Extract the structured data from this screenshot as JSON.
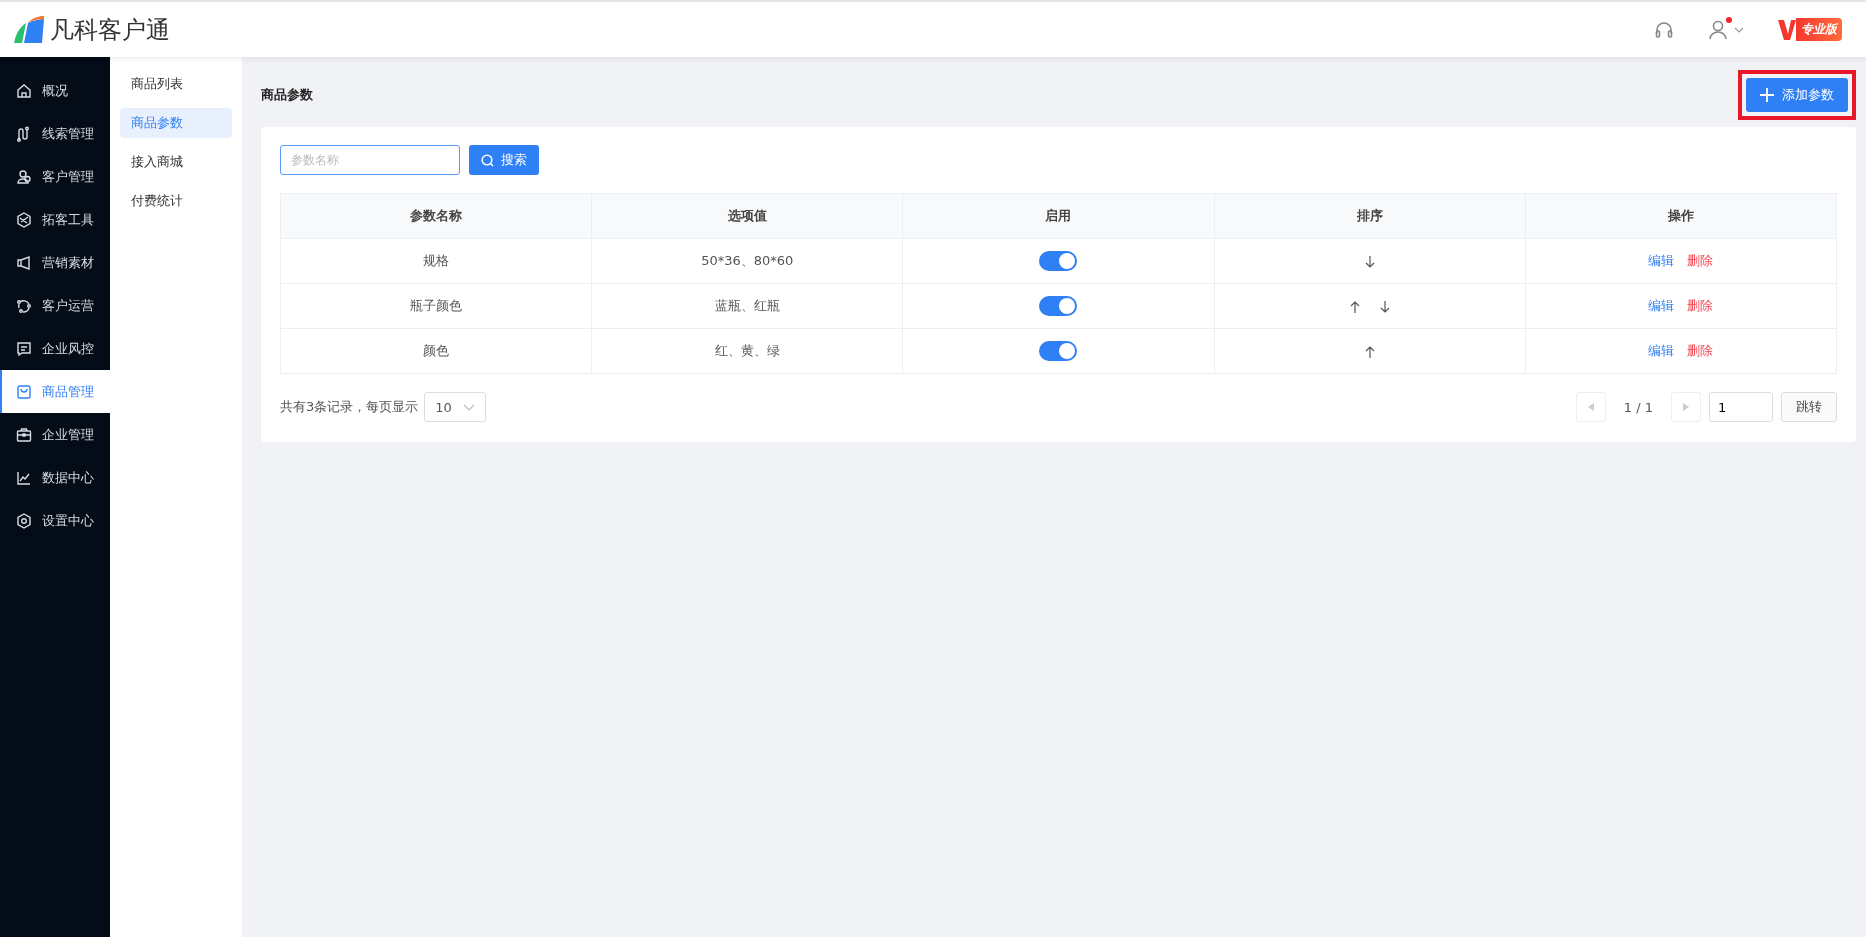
{
  "header": {
    "logo_text": "凡科客户通",
    "edition_badge": "专业版",
    "user_has_notification": true
  },
  "sidebar": {
    "items": [
      {
        "label": "概况",
        "selected": false
      },
      {
        "label": "线索管理",
        "selected": false
      },
      {
        "label": "客户管理",
        "selected": false
      },
      {
        "label": "拓客工具",
        "selected": false
      },
      {
        "label": "营销素材",
        "selected": false
      },
      {
        "label": "客户运营",
        "selected": false
      },
      {
        "label": "企业风控",
        "selected": false
      },
      {
        "label": "商品管理",
        "selected": true
      },
      {
        "label": "企业管理",
        "selected": false
      },
      {
        "label": "数据中心",
        "selected": false
      },
      {
        "label": "设置中心",
        "selected": false
      }
    ]
  },
  "submenu": {
    "items": [
      {
        "label": "商品列表",
        "selected": false
      },
      {
        "label": "商品参数",
        "selected": true
      },
      {
        "label": "接入商城",
        "selected": false
      },
      {
        "label": "付费统计",
        "selected": false
      }
    ]
  },
  "page": {
    "title": "商品参数",
    "add_button": "添加参数",
    "add_button_highlighted": true
  },
  "search": {
    "placeholder": "参数名称",
    "button": "搜索"
  },
  "table": {
    "columns": [
      "参数名称",
      "选项值",
      "启用",
      "排序",
      "操作"
    ],
    "rows": [
      {
        "name": "规格",
        "values": "50*36、80*60",
        "enabled": true,
        "can_move_up": false,
        "can_move_down": true,
        "edit": "编辑",
        "delete": "删除"
      },
      {
        "name": "瓶子颜色",
        "values": "蓝瓶、红瓶",
        "enabled": true,
        "can_move_up": true,
        "can_move_down": true,
        "edit": "编辑",
        "delete": "删除"
      },
      {
        "name": "颜色",
        "values": "红、黄、绿",
        "enabled": true,
        "can_move_up": true,
        "can_move_down": false,
        "edit": "编辑",
        "delete": "删除"
      }
    ]
  },
  "pagination": {
    "summary": "共有3条记录，每页显示",
    "page_size": "10",
    "page_info": "1 / 1",
    "page_input": "1",
    "jump_button": "跳转"
  }
}
